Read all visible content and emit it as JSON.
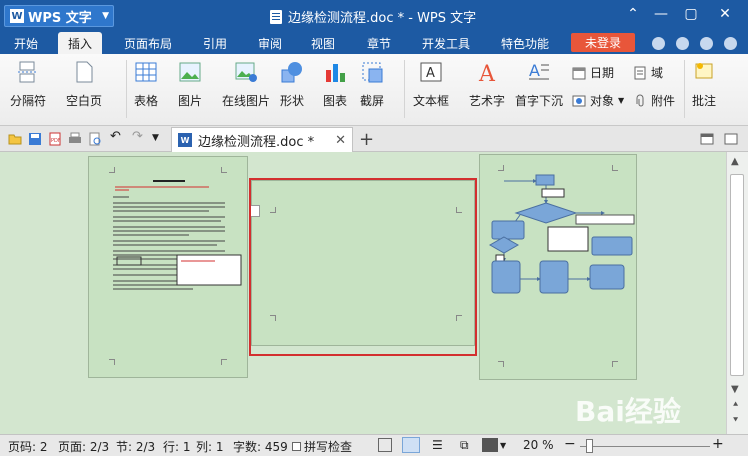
{
  "app": {
    "menu_button_label": "WPS 文字",
    "window_title": "边缘检测流程.doc * - WPS 文字"
  },
  "menu_tabs": [
    "开始",
    "插入",
    "页面布局",
    "引用",
    "审阅",
    "视图",
    "章节",
    "开发工具",
    "特色功能"
  ],
  "active_menu_tab": "插入",
  "login_button": "未登录",
  "ribbon": {
    "section_break": "分隔符",
    "blank_page": "空白页",
    "table": "表格",
    "picture": "图片",
    "online_picture": "在线图片",
    "shape": "形状",
    "chart": "图表",
    "screenshot": "截屏",
    "textbox": "文本框",
    "wordart": "艺术字",
    "drop_cap": "首字下沉",
    "date": "日期",
    "field": "域",
    "object": "对象",
    "attachment": "附件",
    "comment": "批注"
  },
  "doc_tab": {
    "label": "边缘检测流程.doc *"
  },
  "status": {
    "page_number": "页码: 2",
    "pages": "页面: 2/3",
    "section": "节: 2/3",
    "row": "行: 1",
    "column": "列: 1",
    "word_count": "字数: 459",
    "spell_check": "拼写检查",
    "zoom": "20 %"
  },
  "watermark": "Bai经验",
  "colors": {
    "title_bar": "#1d5aa3",
    "login": "#e8563a",
    "page_bg": "#c8e2c2",
    "highlight": "#d32f2f"
  }
}
